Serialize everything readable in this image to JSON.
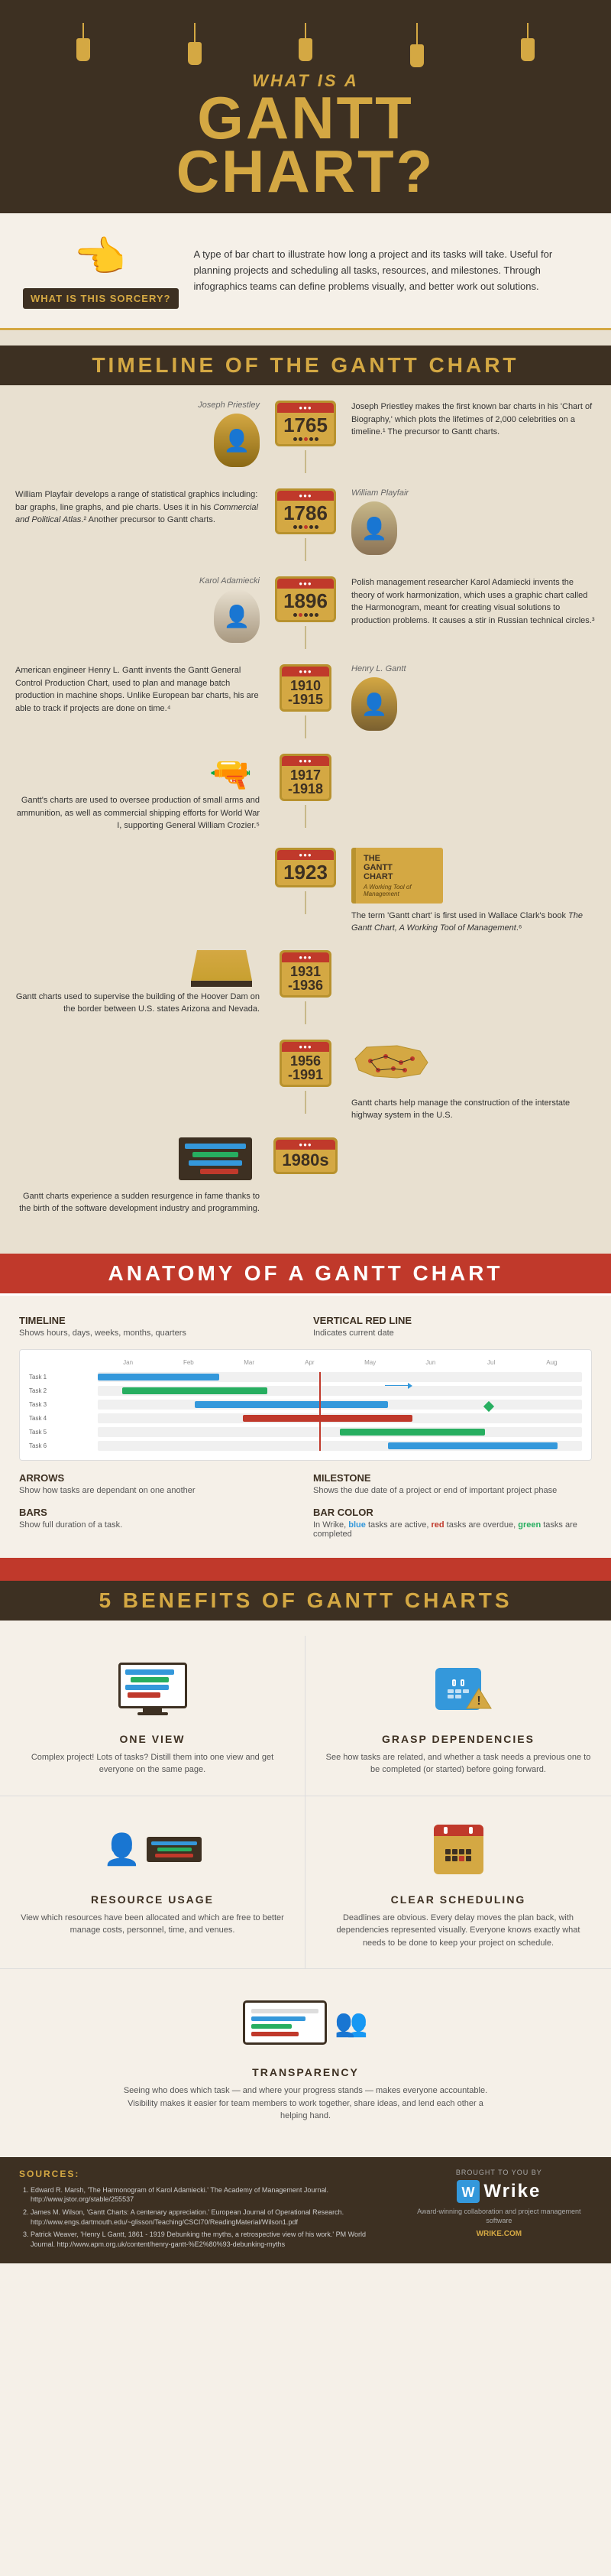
{
  "header": {
    "what_is_a": "What is a",
    "gantt_chart": "Gantt Chart?",
    "question_mark": "?"
  },
  "sorcery": {
    "title": "What is this sorcery?",
    "hand_emoji": "👉",
    "description": "A type of bar chart to illustrate how long a project and its tasks will take. Useful for planning projects and scheduling all tasks, resources, and milestones. Through infographics teams can define problems visually, and better work out solutions."
  },
  "timeline_section": {
    "title": "Timeline of the Gantt Chart",
    "entries": [
      {
        "year": "1765",
        "side": "left",
        "person": "Joseph Priestley",
        "text": "Joseph Priestley makes the first known bar charts in his 'Chart of Biography,' which plots the lifetimes of 2,000 celebrities on a timeline.¹ The precursor to Gantt charts."
      },
      {
        "year": "1786",
        "side": "right",
        "person": "William Playfair",
        "text": "William Playfair develops a range of statistical graphics including: bar graphs, line graphs, and pie charts. Uses it in his Commercial and Political Atlas.² Another precursor to Gantt charts."
      },
      {
        "year": "1896",
        "side": "left",
        "person": "Karol Adamiecki",
        "text": "Polish management researcher Karol Adamiecki invents the theory of work harmonization, which uses a graphic chart called the Harmonogram, meant for creating visual solutions to production problems. It causes a stir in Russian technical circles.³"
      },
      {
        "year": "1910-1915",
        "side": "right",
        "person": "Henry L. Gantt",
        "text": "American engineer Henry L. Gantt invents the Gantt General Control Production Chart, used to plan and manage batch production in machine shops. Unlike European bar charts, his are able to track if projects are done on time.⁴"
      },
      {
        "year": "1917-1918",
        "side": "left",
        "icon": "rifle",
        "text": "Gantt's charts are used to oversee production of small arms and ammunition, as well as commercial shipping efforts for World War I, supporting General William Crozier.⁵"
      },
      {
        "year": "1923",
        "side": "right",
        "icon": "book",
        "text": "The term 'Gantt chart' is first used in Wallace Clark's book The Gantt Chart, A Working Tool of Management.⁶"
      },
      {
        "year": "1931-1936",
        "side": "left",
        "icon": "dam",
        "text": "Gantt charts used to supervise the building of the Hoover Dam on the border between U.S. states Arizona and Nevada."
      },
      {
        "year": "1956-1991",
        "side": "right",
        "icon": "map",
        "text": "Gantt charts help manage the construction of the interstate highway system in the U.S."
      },
      {
        "year": "1980s",
        "side": "left",
        "icon": "computer",
        "text": "Gantt charts experience a sudden resurgence in fame thanks to the birth of the software development industry and programming."
      }
    ]
  },
  "anatomy_section": {
    "title": "Anatomy of a Gantt Chart",
    "labels": [
      {
        "title": "Timeline",
        "description": "Shows hours, days, weeks, months, quarters"
      },
      {
        "title": "Vertical Red Line",
        "description": "Indicates current date"
      },
      {
        "title": "Arrows",
        "description": "Show how tasks are dependant on one another"
      },
      {
        "title": "Milestone",
        "description": "Shows the due date of a project or end of important project phase"
      },
      {
        "title": "Bars",
        "description": "Show full duration of a task."
      },
      {
        "title": "Bar Color",
        "description": "In Wrike, blue tasks are active, red tasks are overdue, green tasks are completed"
      }
    ],
    "months": [
      "Jan",
      "Feb",
      "Mar",
      "Apr",
      "May",
      "Jun",
      "Jul",
      "Aug"
    ],
    "tasks": [
      {
        "label": "Task 1",
        "color": "blue",
        "start": 0,
        "width": 25
      },
      {
        "label": "Task 2",
        "color": "green",
        "start": 5,
        "width": 30
      },
      {
        "label": "Task 3",
        "color": "blue",
        "start": 20,
        "width": 40
      },
      {
        "label": "Task 4",
        "color": "red",
        "start": 30,
        "width": 35
      },
      {
        "label": "Task 5",
        "color": "green",
        "start": 50,
        "width": 30
      },
      {
        "label": "Task 6",
        "color": "blue",
        "start": 60,
        "width": 35
      }
    ]
  },
  "benefits_section": {
    "title": "5 Benefits of Gantt Charts",
    "benefits": [
      {
        "id": "one-view",
        "title": "One View",
        "text": "Complex project! Lots of tasks? Distill them into one view and get everyone on the same page."
      },
      {
        "id": "grasp-dependencies",
        "title": "Grasp Dependencies",
        "text": "See how tasks are related, and whether a task needs a previous one to be completed (or started) before going forward."
      },
      {
        "id": "resource-usage",
        "title": "Resource Usage",
        "text": "View which resources have been allocated and which are free to better manage costs, personnel, time, and venues."
      },
      {
        "id": "clear-scheduling",
        "title": "Clear Scheduling",
        "text": "Deadlines are obvious. Every delay moves the plan back, with dependencies represented visually. Everyone knows exactly what needs to be done to keep your project on schedule."
      },
      {
        "id": "transparency",
        "title": "Transparency",
        "text": "Seeing who does which task — and where your progress stands — makes everyone accountable. Visibility makes it easier for team members to work together, share ideas, and lend each other a helping hand."
      }
    ]
  },
  "sources": {
    "title": "Sources:",
    "items": [
      "Edward R. Marsh, 'The Harmonogram of Karol Adamiecki.' The Academy of Management Journal. http://www.jstor.org/stable/255537",
      "James M. Wilson, 'Gantt Charts: A centenary appreciation.' European Journal of Operational Research. http://www.engs.dartmouth.edu/~glisson/Teaching/CSCI70/ReadingMaterial/Wilson1.pdf",
      "Patrick Weaver, 'Henry L Gantt, 1861 - 1919 Debunking the myths, a retrospective view of his work.' PM World Journal. http://www.apm.org.uk/content/henry-gantt-%E2%80%93-debunking-myths"
    ]
  },
  "wrike": {
    "brought_to_you": "Brought to you by",
    "name": "Wrike",
    "tagline": "Award-winning collaboration and project management software",
    "url": "WRIKE.COM"
  }
}
